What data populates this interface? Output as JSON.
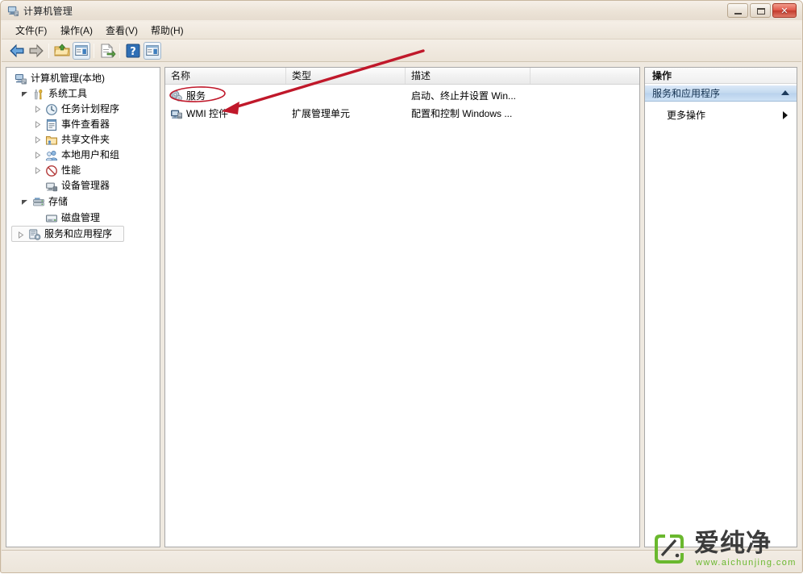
{
  "window": {
    "title": "计算机管理",
    "title_icon": "computer-management-icon",
    "controls": {
      "minimize": "最小化",
      "maximize": "最大化",
      "close": "关闭"
    }
  },
  "menubar": {
    "items": [
      {
        "label": "文件(F)",
        "name": "menu-file"
      },
      {
        "label": "操作(A)",
        "name": "menu-action"
      },
      {
        "label": "查看(V)",
        "name": "menu-view"
      },
      {
        "label": "帮助(H)",
        "name": "menu-help"
      }
    ]
  },
  "toolbar": {
    "buttons": [
      {
        "icon": "back-arrow-icon",
        "title": "后退"
      },
      {
        "icon": "forward-arrow-icon",
        "title": "前进"
      },
      {
        "icon": "up-folder-icon",
        "title": "向上"
      },
      {
        "icon": "show-hide-tree-icon",
        "title": "显示/隐藏控制台树"
      },
      {
        "icon": "export-list-icon",
        "title": "导出列表"
      },
      {
        "icon": "help-icon",
        "title": "帮助"
      },
      {
        "icon": "show-action-pane-icon",
        "title": "显示/隐藏操作窗格"
      }
    ]
  },
  "tree": {
    "items": [
      {
        "label": "计算机管理(本地)",
        "icon": "computer-icon",
        "indent": 0,
        "expander": "none",
        "name": "tree-item-computer-management"
      },
      {
        "label": "系统工具",
        "icon": "system-tools-icon",
        "indent": 1,
        "expander": "expanded",
        "name": "tree-item-system-tools"
      },
      {
        "label": "任务计划程序",
        "icon": "task-scheduler-icon",
        "indent": 2,
        "expander": "collapsed",
        "name": "tree-item-task-scheduler"
      },
      {
        "label": "事件查看器",
        "icon": "event-viewer-icon",
        "indent": 2,
        "expander": "collapsed",
        "name": "tree-item-event-viewer"
      },
      {
        "label": "共享文件夹",
        "icon": "shared-folders-icon",
        "indent": 2,
        "expander": "collapsed",
        "name": "tree-item-shared-folders"
      },
      {
        "label": "本地用户和组",
        "icon": "local-users-groups-icon",
        "indent": 2,
        "expander": "collapsed",
        "name": "tree-item-local-users-and-groups"
      },
      {
        "label": "性能",
        "icon": "performance-icon",
        "indent": 2,
        "expander": "collapsed",
        "name": "tree-item-performance"
      },
      {
        "label": "设备管理器",
        "icon": "device-manager-icon",
        "indent": 2,
        "expander": "none",
        "name": "tree-item-device-manager"
      },
      {
        "label": "存储",
        "icon": "storage-icon",
        "indent": 1,
        "expander": "expanded",
        "name": "tree-item-storage"
      },
      {
        "label": "磁盘管理",
        "icon": "disk-management-icon",
        "indent": 2,
        "expander": "none",
        "name": "tree-item-disk-management"
      },
      {
        "label": "服务和应用程序",
        "icon": "services-and-applications-icon",
        "indent": 1,
        "expander": "collapsed",
        "name": "tree-item-services-and-applications"
      }
    ]
  },
  "list": {
    "columns": [
      {
        "label": "名称",
        "name": "column-name"
      },
      {
        "label": "类型",
        "name": "column-type"
      },
      {
        "label": "描述",
        "name": "column-description"
      }
    ],
    "rows": [
      {
        "name": "服务",
        "type": "",
        "description": "启动、终止并设置 Win...",
        "icon": "services-icon"
      },
      {
        "name": "WMI 控件",
        "type": "扩展管理单元",
        "description": "配置和控制 Windows ...",
        "icon": "wmi-control-icon"
      }
    ]
  },
  "actions": {
    "title": "操作",
    "section_label": "服务和应用程序",
    "more_actions_label": "更多操作"
  },
  "annotations": {
    "ellipse_target": "服务",
    "arrow_color": "#c0182a",
    "ellipse_color": "#c0182a"
  },
  "watermark": {
    "brand": "爱纯净",
    "url": "www.aichunjing.com",
    "accent_color": "#6ab82e"
  },
  "statusbar": {
    "text": ""
  }
}
